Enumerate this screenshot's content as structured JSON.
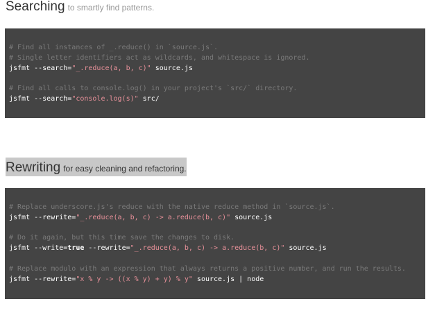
{
  "sections": {
    "searching": {
      "title": "Searching",
      "subtitle": "to smartly find patterns.",
      "lines": {
        "c1": "# Find all instances of _.reduce() in `source.js`.",
        "c2": "# Single letter identifiers act as wildcards, and whitespace is ignored.",
        "cmd1_pre": "jsfmt --search=",
        "cmd1_str": "\"_.reduce(a, b, c)\"",
        "cmd1_post": " source.js",
        "c3": "# Find all calls to console.log() in your project's `src/` directory.",
        "cmd2_pre": "jsfmt --search=",
        "cmd2_str": "\"console.log(s)\"",
        "cmd2_post": " src/"
      }
    },
    "rewriting": {
      "title": "Rewriting",
      "subtitle": "for easy cleaning and refactoring.",
      "lines": {
        "c1": "# Replace underscore.js's reduce with the native reduce method in `source.js`.",
        "cmd1_pre": "jsfmt --rewrite=",
        "cmd1_str": "\"_.reduce(a, b, c) -> a.reduce(b, c)\"",
        "cmd1_post": " source.js",
        "c2": "# Do it again, but this time save the changes to disk.",
        "cmd2_pre": "jsfmt --write=",
        "cmd2_kw": "true",
        "cmd2_mid": " --rewrite=",
        "cmd2_str": "\"_.reduce(a, b, c) -> a.reduce(b, c)\"",
        "cmd2_post": " source.js",
        "c3": "# Replace modulo with an expression that always returns a positive number, and run the results.",
        "cmd3_pre": "jsfmt --rewrite=",
        "cmd3_str": "\"x % y -> ((x % y) + y) % y\"",
        "cmd3_post": " source.js | node"
      }
    }
  },
  "colors": {
    "code_background": "#444444",
    "comment": "#7a7a7a",
    "string": "#e8919a",
    "highlight": "#c8c8c8"
  }
}
